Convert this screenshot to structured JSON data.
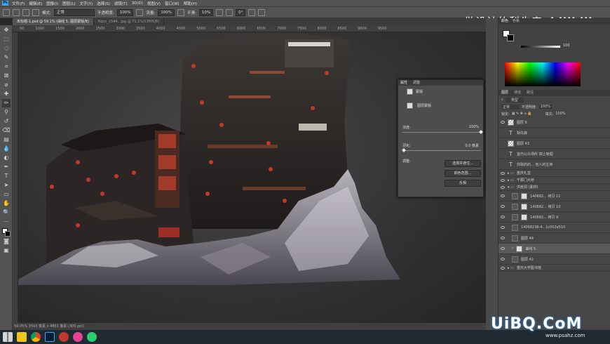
{
  "menu": {
    "logo": "Ps",
    "items": [
      "文件(F)",
      "编辑(E)",
      "图像(I)",
      "图层(L)",
      "文字(Y)",
      "选择(S)",
      "滤镜(T)",
      "3D(D)",
      "视图(V)",
      "窗口(W)",
      "帮助(H)"
    ]
  },
  "options": {
    "mode_label": "模式:",
    "mode_value": "正常",
    "opacity_label": "不透明度:",
    "opacity_value": "100%",
    "flow_label": "流量:",
    "flow_value": "100%",
    "smooth_label": "平滑:",
    "smooth_value": "10%",
    "angle_value": "0°"
  },
  "watermark_top": "做设计的梨先森",
  "tabs": [
    "未标题-1.psd @ 59.1% (曲线 5, 图层蒙版/8)",
    "Nipic_1544...jpg @ 71.1%(CMYK/8)"
  ],
  "ruler_marks": [
    "50",
    "1000",
    "1500",
    "2000",
    "2500",
    "3000",
    "3500",
    "4000",
    "4500",
    "5000",
    "5500",
    "6000",
    "6500",
    "7000",
    "7500",
    "8000",
    "8500",
    "9000",
    "9500"
  ],
  "status": "59.05%    3543 像素 x 4861 像素 (300 ppi)",
  "properties": {
    "tabs": [
      "属性",
      "调整"
    ],
    "title": "蒙版",
    "layer_mask": "图层蒙版",
    "density_label": "浓度:",
    "density_value": "100%",
    "feather_label": "羽化:",
    "feather_value": "0.0 像素",
    "adjust_label": "调整:",
    "btn_select": "选择并遮住...",
    "btn_color": "颜色范围...",
    "btn_invert": "反相"
  },
  "color_panel": {
    "tabs": [
      "颜色",
      "色板"
    ],
    "value": "100"
  },
  "layers_panel": {
    "tabs": [
      "图层",
      "通道",
      "路径"
    ],
    "kind": "类型",
    "blend": "正常",
    "opacity_label": "不透明度:",
    "opacity": "100%",
    "lock_label": "锁定:",
    "fill_label": "填充:",
    "fill": "100%",
    "rows": [
      {
        "name": "图层 6",
        "type": "chk"
      },
      {
        "name": "梨先森",
        "type": "text"
      },
      {
        "name": "图层 43",
        "type": "chk"
      },
      {
        "name": "室内公众场所 禁止吸烟",
        "type": "text"
      },
      {
        "name": "你敢的的... 他人的生命",
        "type": "text"
      },
      {
        "name": "重庆礼堂",
        "type": "folder"
      },
      {
        "name": "千厮门大桥",
        "type": "folder"
      },
      {
        "name": "洪崖洞 (素材)",
        "type": "folder"
      },
      {
        "name": "140682... 拷贝 11",
        "type": "mask"
      },
      {
        "name": "140682... 拷贝 10",
        "type": "mask"
      },
      {
        "name": "140682... 拷贝 9",
        "type": "mask"
      },
      {
        "name": "14068238-4...1c002e510",
        "type": "mask"
      },
      {
        "name": "图层 44",
        "type": "dark"
      },
      {
        "name": "曲线 5",
        "type": "sel"
      },
      {
        "name": "图层 42",
        "type": "dark"
      },
      {
        "name": "重庆大学图书馆",
        "type": "folder"
      }
    ]
  },
  "watermark_bottom": "UiBQ.CoM",
  "watermark_url": "www.psahz.com",
  "colors": {
    "accent": "#31a8ff",
    "panel": "#424242",
    "bar": "#535353"
  }
}
